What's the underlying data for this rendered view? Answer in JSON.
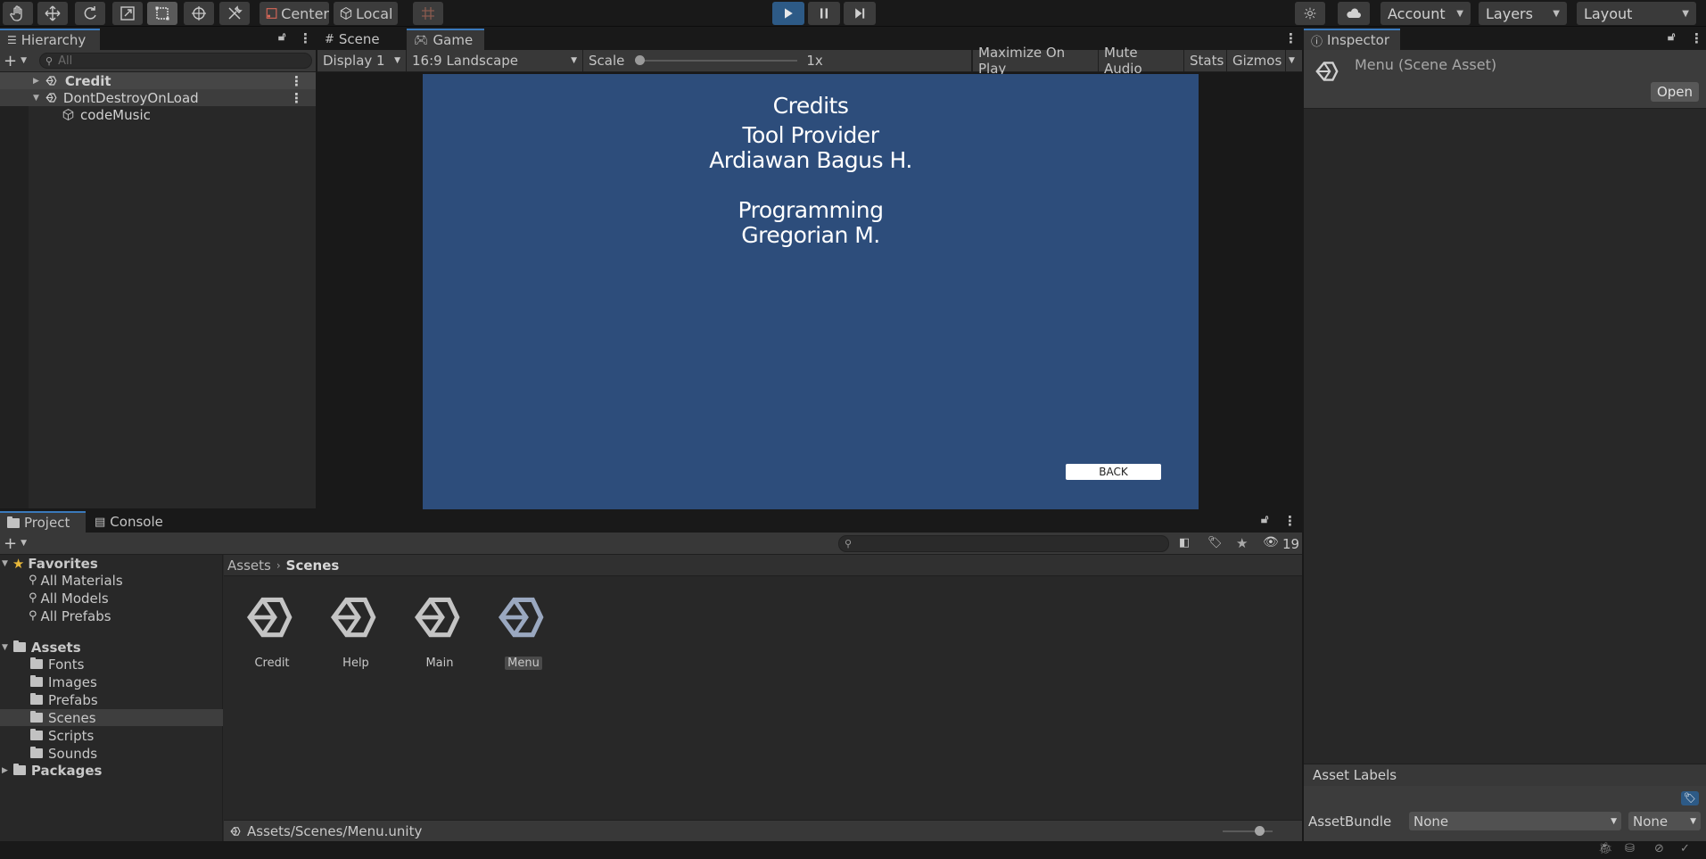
{
  "toolbar": {
    "center_label": "Center",
    "local_label": "Local",
    "account_label": "Account",
    "layers_label": "Layers",
    "layout_label": "Layout",
    "accent_color": "#3a79bb"
  },
  "hierarchy": {
    "tab_label": "Hierarchy",
    "search_placeholder": "All",
    "items": [
      {
        "label": "Credit"
      },
      {
        "label": "DontDestroyOnLoad"
      },
      {
        "label": "codeMusic"
      }
    ]
  },
  "center_tabs": {
    "scene_label": "Scene",
    "game_label": "Game"
  },
  "game_toolbar": {
    "display": "Display 1",
    "aspect": "16:9 Landscape",
    "scale_label": "Scale",
    "scale_value": "1x",
    "maximize": "Maximize On Play",
    "mute": "Mute Audio",
    "stats": "Stats",
    "gizmos": "Gizmos"
  },
  "game_view": {
    "background": "#2d4d7b",
    "lines": [
      "Credits",
      "Tool Provider",
      "Ardiawan Bagus H.",
      "Programming",
      "Gregorian M."
    ],
    "back_button": "BACK"
  },
  "inspector": {
    "tab_label": "Inspector",
    "title": "Menu (Scene Asset)",
    "open_label": "Open",
    "asset_labels": "Asset Labels",
    "assetbundle_label": "AssetBundle",
    "bundle_value": "None",
    "variant_value": "None"
  },
  "project": {
    "project_tab": "Project",
    "console_tab": "Console",
    "hidden_count": "19",
    "favorites_label": "Favorites",
    "favorites": [
      "All Materials",
      "All Models",
      "All Prefabs"
    ],
    "assets_label": "Assets",
    "folders": [
      "Fonts",
      "Images",
      "Prefabs",
      "Scenes",
      "Scripts",
      "Sounds"
    ],
    "packages_label": "Packages",
    "breadcrumb": [
      "Assets",
      "Scenes"
    ],
    "scene_assets": [
      "Credit",
      "Help",
      "Main",
      "Menu"
    ],
    "status_path": "Assets/Scenes/Menu.unity"
  }
}
